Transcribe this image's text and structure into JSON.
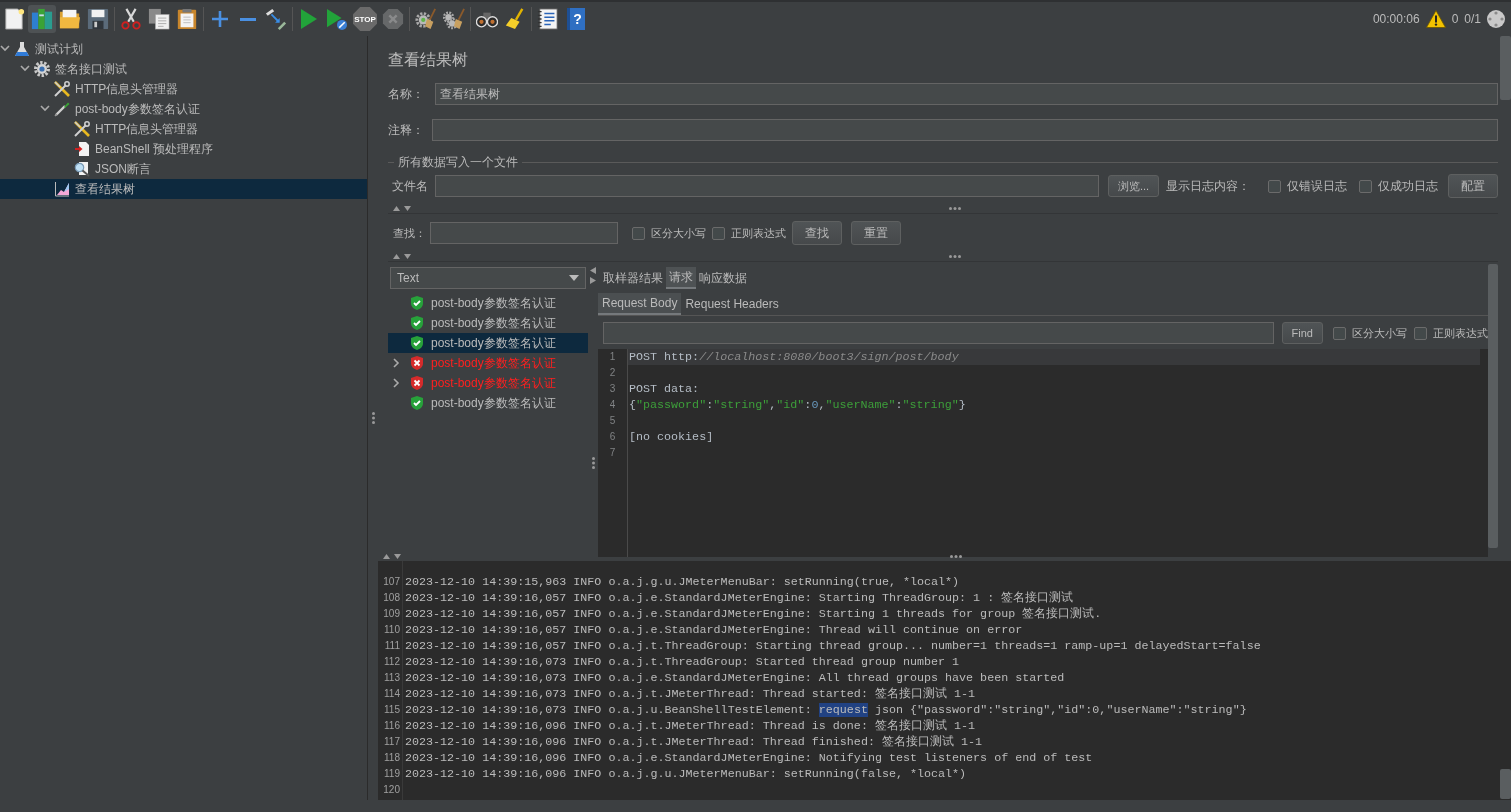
{
  "toolbar": {
    "groups": [
      [
        {
          "kind": "new",
          "disabled": false,
          "hovered": false
        },
        {
          "kind": "templates",
          "disabled": false,
          "hovered": true
        },
        {
          "kind": "open",
          "disabled": false,
          "hovered": false
        },
        {
          "kind": "save",
          "disabled": false,
          "hovered": false
        }
      ],
      [
        {
          "kind": "cut",
          "disabled": false,
          "hovered": false
        },
        {
          "kind": "copy",
          "disabled": false,
          "hovered": false
        },
        {
          "kind": "paste",
          "disabled": false,
          "hovered": false
        }
      ],
      [
        {
          "kind": "expand",
          "disabled": false,
          "hovered": false
        },
        {
          "kind": "collapse",
          "disabled": false,
          "hovered": false
        },
        {
          "kind": "toggle",
          "disabled": false,
          "hovered": false
        }
      ],
      [
        {
          "kind": "start",
          "disabled": false,
          "hovered": false
        },
        {
          "kind": "start_no_pauses",
          "disabled": false,
          "hovered": false
        },
        {
          "kind": "stop",
          "text": "STOP",
          "disabled": true,
          "hovered": false
        },
        {
          "kind": "shutdown",
          "disabled": true,
          "hovered": false
        }
      ],
      [
        {
          "kind": "clear",
          "disabled": false,
          "hovered": false
        },
        {
          "kind": "clear_all",
          "disabled": false,
          "hovered": false
        }
      ],
      [
        {
          "kind": "search",
          "disabled": false,
          "hovered": false
        },
        {
          "kind": "reset_search",
          "disabled": false,
          "hovered": false
        }
      ],
      [
        {
          "kind": "function_helper",
          "disabled": false,
          "hovered": false
        },
        {
          "kind": "help",
          "text": "?",
          "disabled": false,
          "hovered": false
        }
      ]
    ],
    "timer": "00:00:06",
    "error_count": "0",
    "active_threads": "0/1"
  },
  "tree": [
    {
      "label": "测试计划",
      "kind": "test_plan",
      "expanded": true,
      "selected": false,
      "children": [
        {
          "label": "签名接口测试",
          "kind": "thread_group",
          "expanded": true,
          "selected": false,
          "children": [
            {
              "label": "HTTP信息头管理器",
              "kind": "header_manager",
              "selected": false
            },
            {
              "label": "post-body参数签名认证",
              "kind": "sampler",
              "expanded": true,
              "selected": false,
              "children": [
                {
                  "label": "HTTP信息头管理器",
                  "kind": "header_manager",
                  "selected": false
                },
                {
                  "label": "BeanShell 预处理程序",
                  "kind": "preprocessor",
                  "selected": false
                },
                {
                  "label": "JSON断言",
                  "kind": "assertion",
                  "selected": false
                }
              ]
            },
            {
              "label": "查看结果树",
              "kind": "listener",
              "selected": true
            }
          ]
        }
      ]
    }
  ],
  "panel": {
    "title": "查看结果树",
    "name": {
      "label": "名称：",
      "value": "查看结果树"
    },
    "comment": {
      "label": "注释："
    },
    "file_group": {
      "title": "所有数据写入一个文件",
      "filename_label": "文件名",
      "browse_button": "浏览...",
      "log_label": "显示日志内容：",
      "checkboxes": [
        {
          "label": "仅错误日志",
          "checked": false
        },
        {
          "label": "仅成功日志",
          "checked": false
        }
      ],
      "config_button": "配置"
    },
    "search": {
      "label": "查找：",
      "checkboxes": [
        {
          "label": "区分大小写",
          "checked": false
        },
        {
          "label": "正则表达式",
          "checked": false
        }
      ],
      "buttons": [
        "查找",
        "重置"
      ]
    }
  },
  "results": {
    "renderer": "Text",
    "items": [
      {
        "label": "post-body参数签名认证",
        "kind": "pass",
        "selected": false,
        "expandable": false
      },
      {
        "label": "post-body参数签名认证",
        "kind": "pass",
        "selected": false,
        "expandable": false
      },
      {
        "label": "post-body参数签名认证",
        "kind": "pass",
        "selected": true,
        "expandable": false
      },
      {
        "label": "post-body参数签名认证",
        "kind": "fail",
        "selected": false,
        "expandable": true
      },
      {
        "label": "post-body参数签名认证",
        "kind": "fail",
        "selected": false,
        "expandable": true
      },
      {
        "label": "post-body参数签名认证",
        "kind": "pass",
        "selected": false,
        "expandable": false
      }
    ]
  },
  "detail": {
    "tabs": [
      {
        "label": "取样器结果",
        "selected": false
      },
      {
        "label": "请求",
        "selected": true
      },
      {
        "label": "响应数据",
        "selected": false
      }
    ],
    "subtabs": [
      {
        "label": "Request Body",
        "selected": true
      },
      {
        "label": "Request Headers",
        "selected": false
      }
    ],
    "find": {
      "button": "Find",
      "checkboxes": [
        {
          "label": "区分大小写",
          "checked": false
        },
        {
          "label": "正则表达式",
          "checked": false
        }
      ]
    },
    "editor_lines": [
      {
        "number": "1",
        "current": true,
        "tokens": [
          {
            "kind": "plain",
            "text": "POST http:"
          },
          {
            "kind": "comment",
            "text": "//localhost:8080/boot3/sign/post/body"
          }
        ]
      },
      {
        "number": "2",
        "current": false
      },
      {
        "number": "3",
        "current": false,
        "tokens": [
          {
            "kind": "plain",
            "text": "POST data:"
          }
        ]
      },
      {
        "number": "4",
        "current": false,
        "tokens": [
          {
            "kind": "plain",
            "text": "{"
          },
          {
            "kind": "string",
            "text": "\"password\""
          },
          {
            "kind": "plain",
            "text": ":"
          },
          {
            "kind": "string",
            "text": "\"string\""
          },
          {
            "kind": "plain",
            "text": ","
          },
          {
            "kind": "string",
            "text": "\"id\""
          },
          {
            "kind": "plain",
            "text": ":"
          },
          {
            "kind": "number",
            "text": "0"
          },
          {
            "kind": "plain",
            "text": ","
          },
          {
            "kind": "string",
            "text": "\"userName\""
          },
          {
            "kind": "plain",
            "text": ":"
          },
          {
            "kind": "string",
            "text": "\"string\""
          },
          {
            "kind": "plain",
            "text": "}"
          }
        ]
      },
      {
        "number": "5",
        "current": false
      },
      {
        "number": "6",
        "current": false,
        "tokens": [
          {
            "kind": "plain",
            "text": "[no cookies]"
          }
        ]
      },
      {
        "number": "7",
        "current": false
      }
    ]
  },
  "log": {
    "lines": [
      {
        "number": "107",
        "parts": [
          {
            "text": "2023-12-10 14:39:15,963 INFO o.a.j.g.u.JMeterMenuBar: setRunning(true, *local*)",
            "selected": false
          }
        ]
      },
      {
        "number": "108",
        "parts": [
          {
            "text": "2023-12-10 14:39:16,057 INFO o.a.j.e.StandardJMeterEngine: Starting ThreadGroup: 1 : 签名接口测试",
            "selected": false
          }
        ]
      },
      {
        "number": "109",
        "parts": [
          {
            "text": "2023-12-10 14:39:16,057 INFO o.a.j.e.StandardJMeterEngine: Starting 1 threads for group 签名接口测试.",
            "selected": false
          }
        ]
      },
      {
        "number": "110",
        "parts": [
          {
            "text": "2023-12-10 14:39:16,057 INFO o.a.j.e.StandardJMeterEngine: Thread will continue on error",
            "selected": false
          }
        ]
      },
      {
        "number": "111",
        "parts": [
          {
            "text": "2023-12-10 14:39:16,057 INFO o.a.j.t.ThreadGroup: Starting thread group... number=1 threads=1 ramp-up=1 delayedStart=false",
            "selected": false
          }
        ]
      },
      {
        "number": "112",
        "parts": [
          {
            "text": "2023-12-10 14:39:16,073 INFO o.a.j.t.ThreadGroup: Started thread group number 1",
            "selected": false
          }
        ]
      },
      {
        "number": "113",
        "parts": [
          {
            "text": "2023-12-10 14:39:16,073 INFO o.a.j.e.StandardJMeterEngine: All thread groups have been started",
            "selected": false
          }
        ]
      },
      {
        "number": "114",
        "parts": [
          {
            "text": "2023-12-10 14:39:16,073 INFO o.a.j.t.JMeterThread: Thread started: 签名接口测试 1-1",
            "selected": false
          }
        ]
      },
      {
        "number": "115",
        "parts": [
          {
            "text": "2023-12-10 14:39:16,073 INFO o.a.j.u.BeanShellTestElement: ",
            "selected": false
          },
          {
            "text": "request",
            "selected": true
          },
          {
            "text": " json {\"password\":\"string\",\"id\":0,\"userName\":\"string\"}",
            "selected": false
          }
        ]
      },
      {
        "number": "116",
        "parts": [
          {
            "text": "2023-12-10 14:39:16,096 INFO o.a.j.t.JMeterThread: Thread is done: 签名接口测试 1-1",
            "selected": false
          }
        ]
      },
      {
        "number": "117",
        "parts": [
          {
            "text": "2023-12-10 14:39:16,096 INFO o.a.j.t.JMeterThread: Thread finished: 签名接口测试 1-1",
            "selected": false
          }
        ]
      },
      {
        "number": "118",
        "parts": [
          {
            "text": "2023-12-10 14:39:16,096 INFO o.a.j.e.StandardJMeterEngine: Notifying test listeners of end of test",
            "selected": false
          }
        ]
      },
      {
        "number": "119",
        "parts": [
          {
            "text": "2023-12-10 14:39:16,096 INFO o.a.j.g.u.JMeterMenuBar: setRunning(false, *local*)",
            "selected": false
          }
        ]
      },
      {
        "number": "120"
      }
    ]
  }
}
